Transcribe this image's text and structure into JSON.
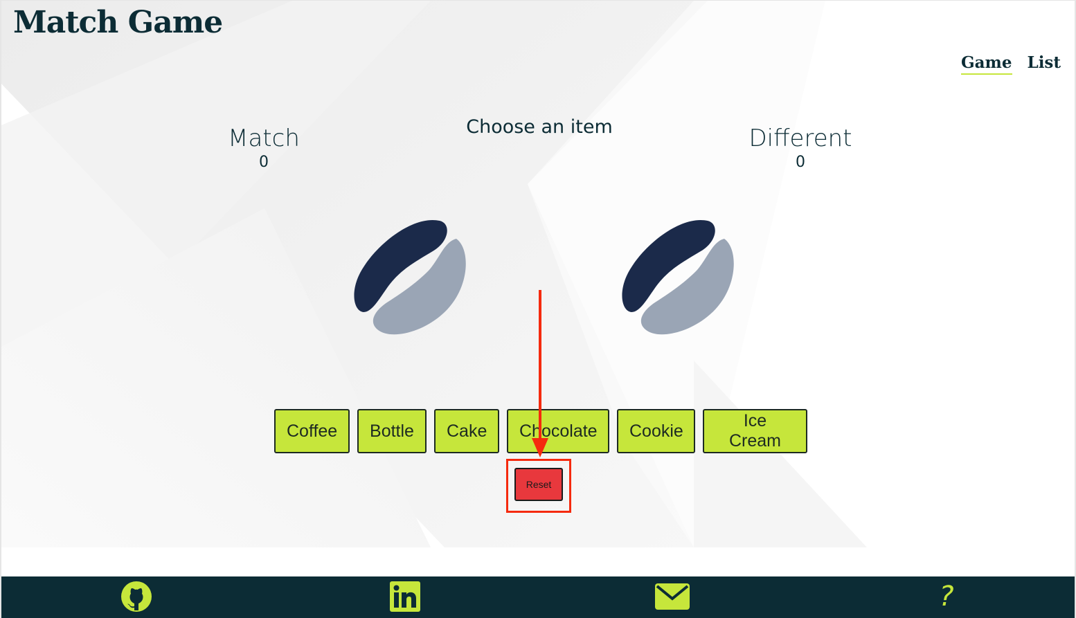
{
  "app": {
    "title": "Match Game"
  },
  "nav": {
    "items": [
      {
        "label": "Game",
        "active": true
      },
      {
        "label": "List",
        "active": false
      }
    ]
  },
  "game": {
    "prompt": "Choose an item",
    "match": {
      "label": "Match",
      "value": "0"
    },
    "different": {
      "label": "Different",
      "value": "0"
    },
    "left_image": "coffee-bean-icon",
    "right_image": "coffee-bean-icon",
    "choices": [
      "Coffee",
      "Bottle",
      "Cake",
      "Chocolate",
      "Cookie",
      "Ice Cream"
    ],
    "reset_label": "Reset"
  },
  "footer": {
    "icons": [
      "github-icon",
      "linkedin-icon",
      "mail-icon",
      "help-icon"
    ],
    "help_glyph": "?"
  },
  "colors": {
    "accent_green": "#c6e63b",
    "dark_navy": "#0c2c35",
    "reset_red": "#e8383d",
    "annotation_red": "#f52a0e",
    "bean_dark": "#1b2a4a",
    "bean_light": "#9aa5b5"
  }
}
